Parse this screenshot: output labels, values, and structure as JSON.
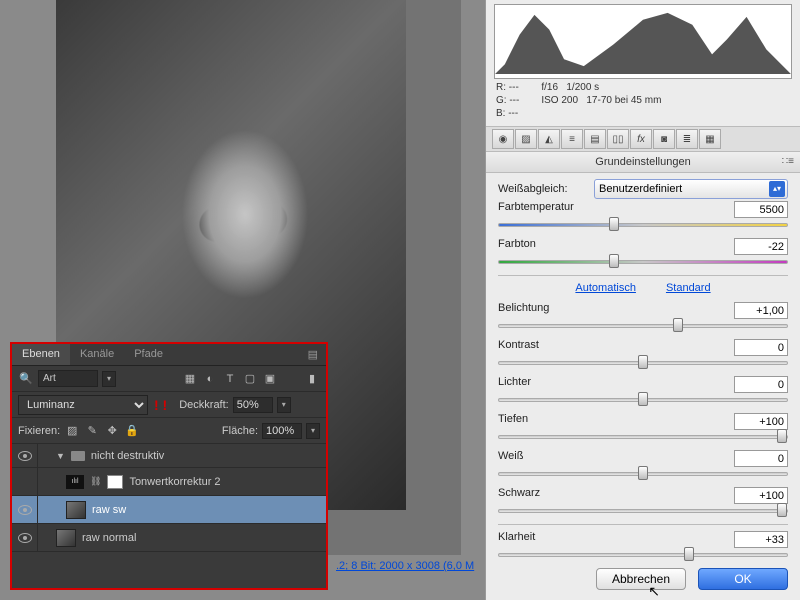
{
  "status_text": ".2; 8 Bit; 2000 x 3008 (6,0 M",
  "layers_panel": {
    "tabs": [
      "Ebenen",
      "Kanäle",
      "Pfade"
    ],
    "search_placeholder": "Art",
    "blend_mode": "Luminanz",
    "opacity_label": "Deckkraft:",
    "opacity_value": "50%",
    "lock_label": "Fixieren:",
    "fill_label": "Fläche:",
    "fill_value": "100%",
    "items": {
      "group_name": "nicht destruktiv",
      "adj_name": "Tonwertkorrektur 2",
      "layer_sw": "raw sw",
      "layer_normal": "raw normal"
    }
  },
  "raw": {
    "readout": {
      "r": "R:   ---",
      "g": "G:   ---",
      "b": "B:   ---",
      "aperture": "f/16",
      "shutter": "1/200 s",
      "iso": "ISO 200",
      "lens": "17-70 bei 45 mm"
    },
    "section": "Grundeinstellungen",
    "wb_label": "Weißabgleich:",
    "wb_value": "Benutzerdefiniert",
    "links": {
      "auto": "Automatisch",
      "std": "Standard"
    },
    "sliders": {
      "temp": {
        "label": "Farbtemperatur",
        "value": "5500",
        "pos": 40
      },
      "tint": {
        "label": "Farbton",
        "value": "-22",
        "pos": 40
      },
      "exp": {
        "label": "Belichtung",
        "value": "+1,00",
        "pos": 62
      },
      "contr": {
        "label": "Kontrast",
        "value": "0",
        "pos": 50
      },
      "high": {
        "label": "Lichter",
        "value": "0",
        "pos": 50
      },
      "shad": {
        "label": "Tiefen",
        "value": "+100",
        "pos": 98
      },
      "white": {
        "label": "Weiß",
        "value": "0",
        "pos": 50
      },
      "black": {
        "label": "Schwarz",
        "value": "+100",
        "pos": 98
      },
      "clar": {
        "label": "Klarheit",
        "value": "+33",
        "pos": 66
      }
    },
    "buttons": {
      "cancel": "Abbrechen",
      "ok": "OK"
    }
  }
}
